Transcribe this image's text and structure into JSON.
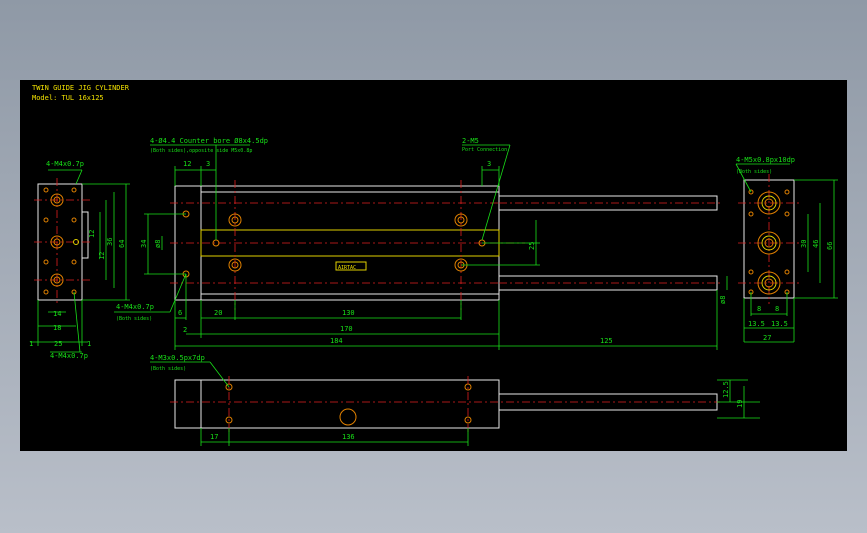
{
  "title": {
    "line1": "TWIN GUIDE JIG CYLINDER",
    "line2": "Model: TUL 16x125"
  },
  "labels": {
    "counterbore": "4-Ø4.4 Counter bore Ø8x4.5dp",
    "counterbore_sub": "(Both sides),opposite side M5x0.8p",
    "port": "2-M5",
    "port_sub": "Port Connection",
    "left_top": "4-M4x0.7p",
    "left_bottom": "4-M4x0.7p",
    "mid_left": "4-M4x0.7p",
    "mid_left_sub": "(Both sides)",
    "right_top": "4-M5x0.8px10dp",
    "right_top_sub": "(Both sides)",
    "bottom_view": "4-M3x0.5px7dp",
    "bottom_view_sub": "(Both sides)",
    "nameplate": "AIRTAC"
  },
  "dims": {
    "d12": "12",
    "d3a": "3",
    "d3b": "3",
    "d6": "6",
    "d2": "2",
    "d20": "20",
    "d130": "130",
    "d170": "170",
    "d184": "184",
    "d125": "125",
    "d34": "34",
    "d8v": "ø8",
    "d25v": "25",
    "d8r": "ø8",
    "lv25": "25",
    "lv18": "18",
    "lv14": "14",
    "lv1a": "1",
    "lv1b": "1",
    "lv12a": "12",
    "lv12b": "12",
    "lv36": "36",
    "lv64": "64",
    "rv30": "30",
    "rv46": "46",
    "rv66": "66",
    "rv8a": "8",
    "rv8b": "8",
    "rv135a": "13.5",
    "rv135b": "13.5",
    "rv27": "27",
    "bv17": "17",
    "bv136": "136",
    "bv125": "12.5",
    "bv19": "19"
  }
}
